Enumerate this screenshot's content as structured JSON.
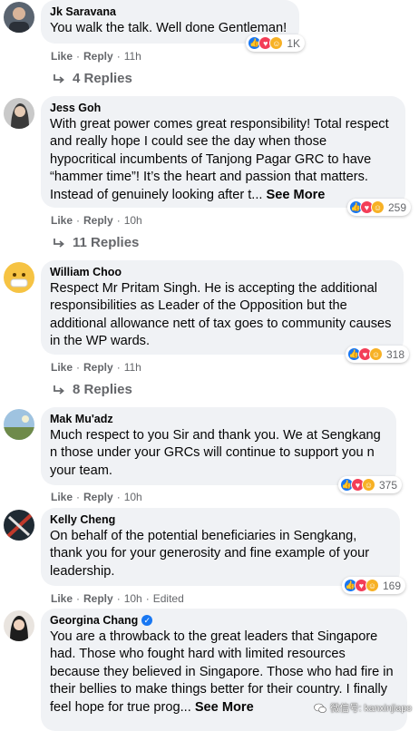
{
  "colors": {
    "bubble": "#f0f2f5",
    "meta": "#65676b",
    "like": "#1877f2",
    "love": "#f33e58",
    "care": "#f7b125"
  },
  "labels": {
    "like": "Like",
    "reply": "Reply",
    "separator": "·"
  },
  "comments": [
    {
      "author": "Jk Saravana",
      "text": "You walk the talk. Well done Gentleman!",
      "see_more": "",
      "reactions": "1K",
      "time": "11h",
      "edited": "",
      "replies": "4 Replies"
    },
    {
      "author": "Jess Goh",
      "text": "With great power comes great responsibility! Total respect and really hope I could see the day when those hypocritical incumbents of Tanjong Pagar GRC to have “hammer time”! It’s the heart and passion that matters. Instead of genuinely looking after t...",
      "see_more": "See More",
      "reactions": "259",
      "time": "10h",
      "edited": "",
      "replies": "11 Replies"
    },
    {
      "author": "William Choo",
      "text": "Respect Mr Pritam Singh. He is accepting the additional responsibilities as Leader of the Opposition but the additional allowance nett of tax goes to community causes in the WP wards.",
      "see_more": "",
      "reactions": "318",
      "time": "11h",
      "edited": "",
      "replies": "8 Replies"
    },
    {
      "author": "Mak Mu'adz",
      "text": "Much respect to you Sir and thank you. We at Sengkang n those under your GRCs will continue to support you n your team.",
      "see_more": "",
      "reactions": "375",
      "time": "10h",
      "edited": "",
      "replies": ""
    },
    {
      "author": "Kelly Cheng",
      "text": "On behalf of the potential beneficiaries in Sengkang, thank you for your generosity and fine example of your leadership.",
      "see_more": "",
      "reactions": "169",
      "time": "10h",
      "edited": "Edited",
      "replies": ""
    },
    {
      "author": "Georgina Chang",
      "text": "You are a throwback to the great leaders that Singapore had. Those who fought hard with limited resources because they believed in Singapore. Those who had fire in their bellies to make things better for their country. I finally feel hope for true prog...",
      "see_more": "See More",
      "reactions": "",
      "time": "",
      "edited": "",
      "replies": ""
    }
  ],
  "watermark": "微信号: kanxinjiapo"
}
